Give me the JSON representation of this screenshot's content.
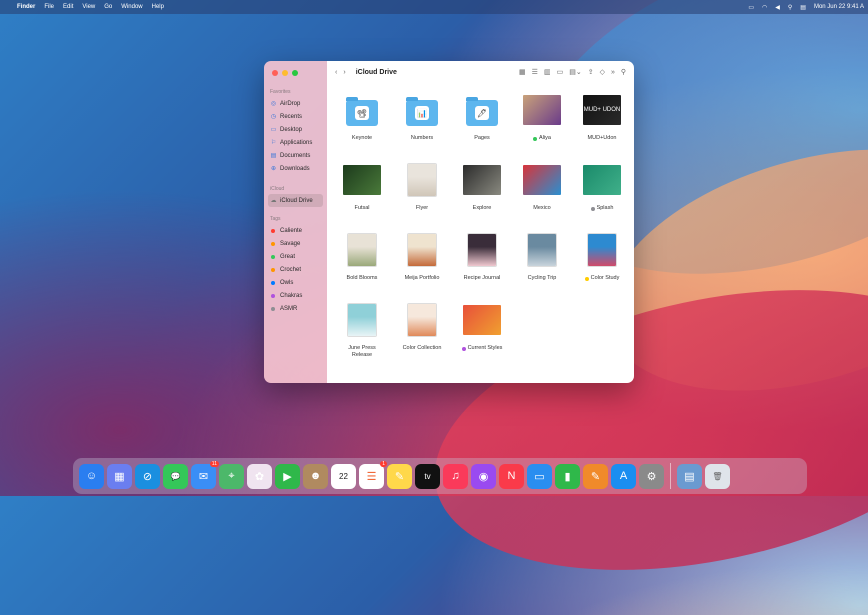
{
  "menubar": {
    "app": "Finder",
    "items": [
      "File",
      "Edit",
      "View",
      "Go",
      "Window",
      "Help"
    ],
    "clock": "Mon Jun 22  9:41 A"
  },
  "window": {
    "title": "iCloud Drive",
    "sidebar": {
      "favorites_label": "Favorites",
      "favorites": [
        {
          "label": "AirDrop",
          "icon": "airdrop-icon"
        },
        {
          "label": "Recents",
          "icon": "clock-icon"
        },
        {
          "label": "Desktop",
          "icon": "desktop-icon"
        },
        {
          "label": "Applications",
          "icon": "applications-icon"
        },
        {
          "label": "Documents",
          "icon": "document-icon"
        },
        {
          "label": "Downloads",
          "icon": "download-icon"
        }
      ],
      "icloud_label": "iCloud",
      "icloud": [
        {
          "label": "iCloud Drive",
          "icon": "cloud-icon"
        }
      ],
      "tags_label": "Tags",
      "tags": [
        {
          "label": "Caliente",
          "color": "#ff3b30"
        },
        {
          "label": "Savage",
          "color": "#ff9500"
        },
        {
          "label": "Great",
          "color": "#34c759"
        },
        {
          "label": "Crochet",
          "color": "#ff9500"
        },
        {
          "label": "Owls",
          "color": "#007aff"
        },
        {
          "label": "Chakras",
          "color": "#af52de"
        },
        {
          "label": "ASMR",
          "color": "#8e8e93"
        }
      ]
    },
    "files": [
      {
        "name": "Keynote",
        "kind": "folder",
        "glyph": "📽"
      },
      {
        "name": "Numbers",
        "kind": "folder",
        "glyph": "📊"
      },
      {
        "name": "Pages",
        "kind": "folder",
        "glyph": "🖊"
      },
      {
        "name": "Aliya",
        "kind": "image",
        "tag": "#34c759",
        "c1": "#c9a27a",
        "c2": "#6a3b8a"
      },
      {
        "name": "MUD+Udon",
        "kind": "image",
        "c1": "#111",
        "c2": "#2a2a2a",
        "text": "MUD+ UDON"
      },
      {
        "name": "Futsal",
        "kind": "image",
        "c1": "#1c3a1c",
        "c2": "#4a7a3a"
      },
      {
        "name": "Flyer",
        "kind": "doc",
        "c1": "#e9e4dc",
        "c2": "#d0c6b8"
      },
      {
        "name": "Explore",
        "kind": "image",
        "c1": "#2b2b2b",
        "c2": "#8a8a80"
      },
      {
        "name": "Mexico",
        "kind": "image",
        "c1": "#d8343a",
        "c2": "#2a8fd0"
      },
      {
        "name": "Splash",
        "kind": "image",
        "tag": "#8e8e93",
        "c1": "#1a8a6a",
        "c2": "#40b08a"
      },
      {
        "name": "Bold Blooms",
        "kind": "doc",
        "c1": "#e8e2d6",
        "c2": "#9aa87a"
      },
      {
        "name": "Meija Portfolio",
        "kind": "doc",
        "c1": "#efe3cf",
        "c2": "#c46a3a"
      },
      {
        "name": "Recipe Journal",
        "kind": "doc",
        "c1": "#3a2d3a",
        "c2": "#f0c8d0"
      },
      {
        "name": "Cycling Trip",
        "kind": "doc",
        "c1": "#6a8aa0",
        "c2": "#c8d4dc"
      },
      {
        "name": "Color Study",
        "kind": "doc",
        "tag": "#ffcc00",
        "c1": "#2d8ad0",
        "c2": "#d04a6a"
      },
      {
        "name": "June Press Release",
        "kind": "doc",
        "c1": "#8fd0d8",
        "c2": "#e8f4f6"
      },
      {
        "name": "Color Collection",
        "kind": "doc",
        "c1": "#f6e8dc",
        "c2": "#e08a5a"
      },
      {
        "name": "Current Styles",
        "kind": "image",
        "tag": "#af52de",
        "c1": "#e8503a",
        "c2": "#f0a030"
      }
    ]
  },
  "dock": [
    {
      "name": "finder",
      "bg": "#2a7ef0",
      "glyph": "☺"
    },
    {
      "name": "launchpad",
      "bg": "#6a7ef0",
      "glyph": "▦"
    },
    {
      "name": "safari",
      "bg": "#1a8fe0",
      "glyph": "⊘"
    },
    {
      "name": "messages",
      "bg": "#34c759",
      "glyph": "💬"
    },
    {
      "name": "mail",
      "bg": "#3a8ef6",
      "glyph": "✉",
      "badge": "11"
    },
    {
      "name": "maps",
      "bg": "#4cb86a",
      "glyph": "⌖"
    },
    {
      "name": "photos",
      "bg": "#f0e4f0",
      "glyph": "✿"
    },
    {
      "name": "facetime",
      "bg": "#2fb84a",
      "glyph": "▶"
    },
    {
      "name": "contacts",
      "bg": "#b08a60",
      "glyph": "☻"
    },
    {
      "name": "calendar",
      "bg": "#ffffff",
      "glyph": "22",
      "text_color": "#222"
    },
    {
      "name": "reminders",
      "bg": "#ffffff",
      "glyph": "☰",
      "text_color": "#f06a3a",
      "badge": "1"
    },
    {
      "name": "notes",
      "bg": "#ffd84a",
      "glyph": "✎"
    },
    {
      "name": "tv",
      "bg": "#111111",
      "glyph": "tv"
    },
    {
      "name": "music",
      "bg": "#fa3a5a",
      "glyph": "♫"
    },
    {
      "name": "podcasts",
      "bg": "#9a4af0",
      "glyph": "◉"
    },
    {
      "name": "news",
      "bg": "#fa3a4a",
      "glyph": "N"
    },
    {
      "name": "keynote",
      "bg": "#2a8ef0",
      "glyph": "▭"
    },
    {
      "name": "numbers",
      "bg": "#2fb84a",
      "glyph": "▮"
    },
    {
      "name": "pages",
      "bg": "#f08a2a",
      "glyph": "✎"
    },
    {
      "name": "app-store",
      "bg": "#1a8ef0",
      "glyph": "A"
    },
    {
      "name": "system-preferences",
      "bg": "#8a8a8a",
      "glyph": "⚙"
    }
  ],
  "dock_right": [
    {
      "name": "preview",
      "bg": "#6a9ad0",
      "glyph": "▤"
    },
    {
      "name": "trash",
      "bg": "#dfe4ea",
      "glyph": "🗑",
      "text_color": "#666"
    }
  ]
}
